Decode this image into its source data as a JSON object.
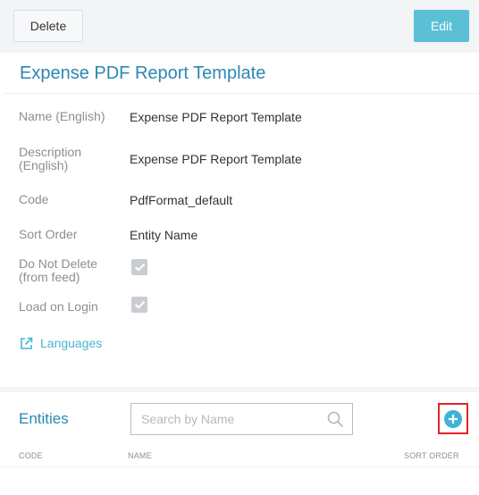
{
  "toolbar": {
    "delete_label": "Delete",
    "edit_label": "Edit"
  },
  "detail": {
    "title": "Expense PDF Report Template",
    "fields": [
      {
        "label": "Name (English)",
        "value": "Expense PDF Report Template"
      },
      {
        "label": "Description (English)",
        "value": "Expense PDF Report Template"
      },
      {
        "label": "Code",
        "value": "PdfFormat_default"
      },
      {
        "label": "Sort Order",
        "value": "Entity Name"
      },
      {
        "label": "Do Not Delete (from feed)",
        "checked": true
      },
      {
        "label": "Load on Login",
        "checked": true
      }
    ],
    "languages_link": "Languages",
    "languages_icon": "external-link-icon"
  },
  "entities": {
    "title": "Entities",
    "search_placeholder": "Search by Name",
    "search_icon": "search-icon",
    "add_icon": "plus-circle-icon",
    "columns": [
      "CODE",
      "NAME",
      "SORT ORDER"
    ]
  },
  "colors": {
    "accent": "#2b87b4",
    "edit_button": "#5bc0d6",
    "link": "#49b4d1",
    "highlight": "#e0242a"
  }
}
